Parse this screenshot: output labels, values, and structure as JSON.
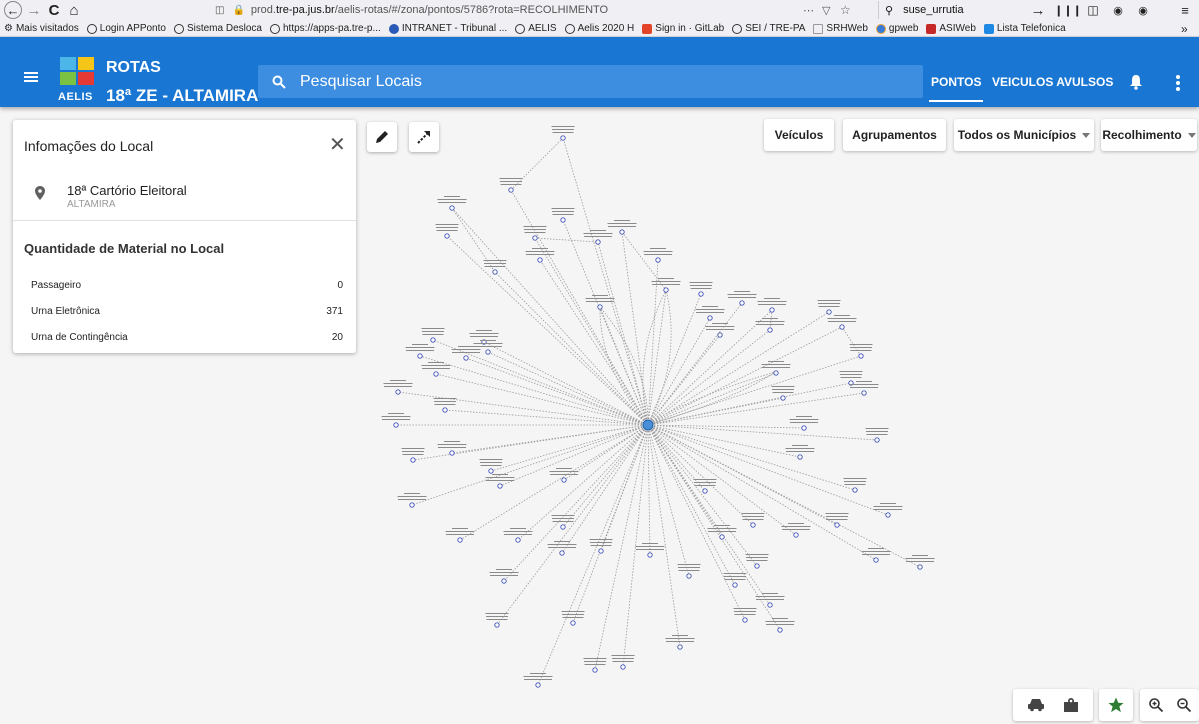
{
  "browser": {
    "url_prefix": "prod.",
    "url_host": "tre-pa.jus.br",
    "url_path": "/aelis-rotas/#/zona/pontos/5786?rota=RECOLHIMENTO",
    "search_value": "suse_urrutia",
    "bookmarks": [
      "Mais visitados",
      "Login APPonto",
      "Sistema Desloca",
      "https://apps-pa.tre-p...",
      "INTRANET - Tribunal ...",
      "AELIS",
      "Aelis 2020 H",
      "Sign in · GitLab",
      "SEI / TRE-PA",
      "SRHWeb",
      "gpweb",
      "ASIWeb",
      "Lista Telefonica"
    ]
  },
  "header": {
    "logo_text": "AELIS",
    "title": "ROTAS",
    "subtitle": "18ª ZE - ALTAMIRA",
    "search_placeholder": "Pesquisar Locais",
    "tabs": [
      "PONTOS",
      "VEICULOS AVULSOS"
    ],
    "active_tab": "PONTOS",
    "colors": {
      "header_bg": "#1976d2",
      "search_bg": "#3d8ee0"
    }
  },
  "info_panel": {
    "title": "Infomações do Local",
    "place_name": "18ª Cartório Eleitoral",
    "place_city": "ALTAMIRA",
    "section_title": "Quantidade de Material no Local",
    "materials": [
      {
        "label": "Passageiro",
        "value": "0"
      },
      {
        "label": "Urna Eletrônica",
        "value": "371"
      },
      {
        "label": "Urna de Contingência",
        "value": "20"
      }
    ]
  },
  "toolbar": {
    "edit_icon": "pencil-icon",
    "route_icon": "arrow-diagonal-icon",
    "buttons": [
      "Veículos",
      "Agrupamentos"
    ],
    "municipio_select": "Todos os Municípios",
    "rota_select": "Recolhimento"
  },
  "bottom_controls": [
    "car-icon",
    "person-pin-icon",
    "star-icon",
    "zoom-in-icon",
    "zoom-out-icon"
  ]
}
